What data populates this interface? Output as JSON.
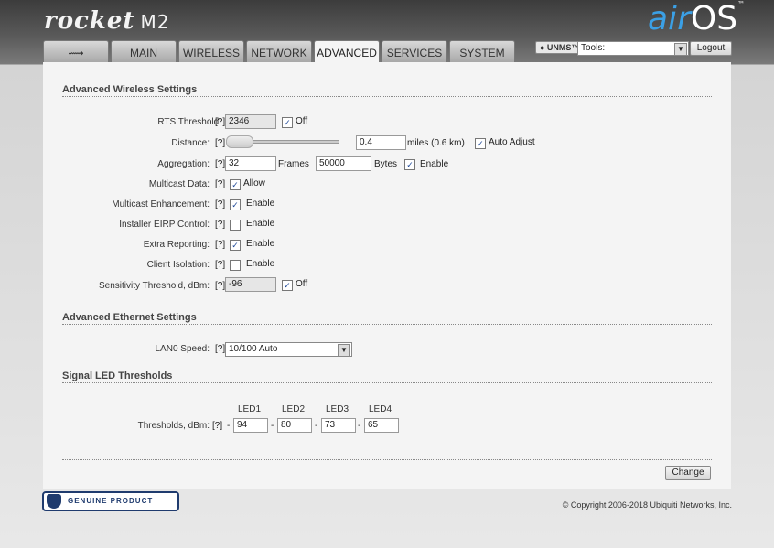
{
  "brand": {
    "model": "rocket",
    "variant": "M2",
    "os_air": "air",
    "os_os": "OS",
    "tm": "™"
  },
  "tabs": [
    "MAIN",
    "WIRELESS",
    "NETWORK",
    "ADVANCED",
    "SERVICES",
    "SYSTEM"
  ],
  "header": {
    "unms": "● UNMS™",
    "tools_value": "Tools:",
    "logout": "Logout"
  },
  "sections": {
    "wireless": "Advanced Wireless Settings",
    "ethernet": "Advanced Ethernet Settings",
    "led": "Signal LED Thresholds"
  },
  "help": "[?]",
  "fields": {
    "rts": {
      "label": "RTS Threshold:",
      "value": "2346",
      "cb": "Off"
    },
    "distance": {
      "label": "Distance:",
      "value": "0.4",
      "unit": "miles (0.6 km)",
      "cb": "Auto Adjust"
    },
    "aggregation": {
      "label": "Aggregation:",
      "frames": "32",
      "frames_label": "Frames",
      "bytes": "50000",
      "bytes_label": "Bytes",
      "cb": "Enable"
    },
    "multicast": {
      "label": "Multicast Data:",
      "cb": "Allow"
    },
    "mcast_enh": {
      "label": "Multicast Enhancement:",
      "cb": "Enable"
    },
    "eirp": {
      "label": "Installer EIRP Control:",
      "cb": "Enable"
    },
    "extra": {
      "label": "Extra Reporting:",
      "cb": "Enable"
    },
    "isolation": {
      "label": "Client Isolation:",
      "cb": "Enable"
    },
    "sens": {
      "label": "Sensitivity Threshold, dBm:",
      "value": "-96",
      "cb": "Off"
    },
    "lan": {
      "label": "LAN0 Speed:",
      "value": "10/100 Auto"
    },
    "thresholds": {
      "label": "Thresholds, dBm:",
      "heads": [
        "LED1",
        "LED2",
        "LED3",
        "LED4"
      ],
      "values": [
        "94",
        "80",
        "73",
        "65"
      ],
      "dash": "-"
    }
  },
  "change": "Change",
  "badge": "GENUINE PRODUCT",
  "copyright": "© Copyright 2006-2018 Ubiquiti Networks, Inc."
}
